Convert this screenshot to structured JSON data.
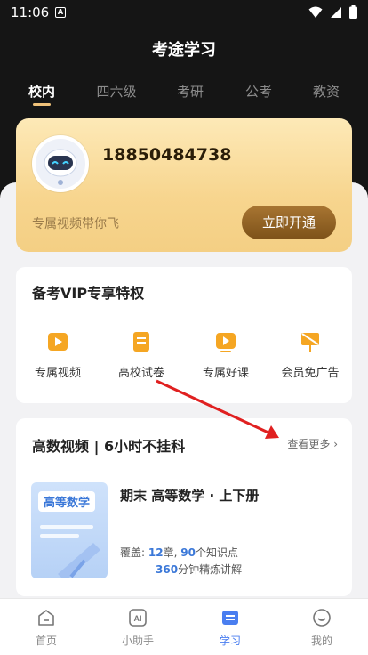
{
  "status_bar": {
    "time": "11:06",
    "app_badge": "A"
  },
  "app_title": "考途学习",
  "tabs": [
    {
      "label": "校内",
      "active": true
    },
    {
      "label": "四六级",
      "active": false
    },
    {
      "label": "考研",
      "active": false
    },
    {
      "label": "公考",
      "active": false
    },
    {
      "label": "教资",
      "active": false
    }
  ],
  "vip_card": {
    "phone": "18850484738",
    "slogan": "专属视频带你飞",
    "button": "立即开通"
  },
  "privileges": {
    "title": "备考VIP专享特权",
    "items": [
      {
        "label": "专属视频",
        "icon": "video-icon"
      },
      {
        "label": "高校试卷",
        "icon": "exam-paper-icon"
      },
      {
        "label": "专属好课",
        "icon": "course-play-icon"
      },
      {
        "label": "会员免广告",
        "icon": "no-ads-icon"
      }
    ]
  },
  "course_section": {
    "title": "高数视频 | 6小时不挂科",
    "see_more": "查看更多 ›",
    "course": {
      "cover_tag": "高等数学",
      "name": "期末 高等数学 · 上下册",
      "meta_prefix": "覆盖:",
      "chapters": "12",
      "chapters_unit": "章,",
      "points": "90",
      "points_unit": "个知识点",
      "minutes": "360",
      "minutes_unit": "分钟精炼讲解"
    }
  },
  "bottom_nav": [
    {
      "label": "首页",
      "icon": "home-icon",
      "active": false
    },
    {
      "label": "小助手",
      "icon": "ai-assistant-icon",
      "active": false
    },
    {
      "label": "学习",
      "icon": "study-icon",
      "active": true
    },
    {
      "label": "我的",
      "icon": "profile-smile-icon",
      "active": false
    }
  ],
  "colors": {
    "accent_gold": "#f0c27a",
    "button_brown": "#8a5c1f",
    "link_blue": "#3b78d8",
    "nav_active": "#4a7ef0",
    "icon_orange": "#f5a623",
    "annotation_arrow": "#e02020"
  }
}
